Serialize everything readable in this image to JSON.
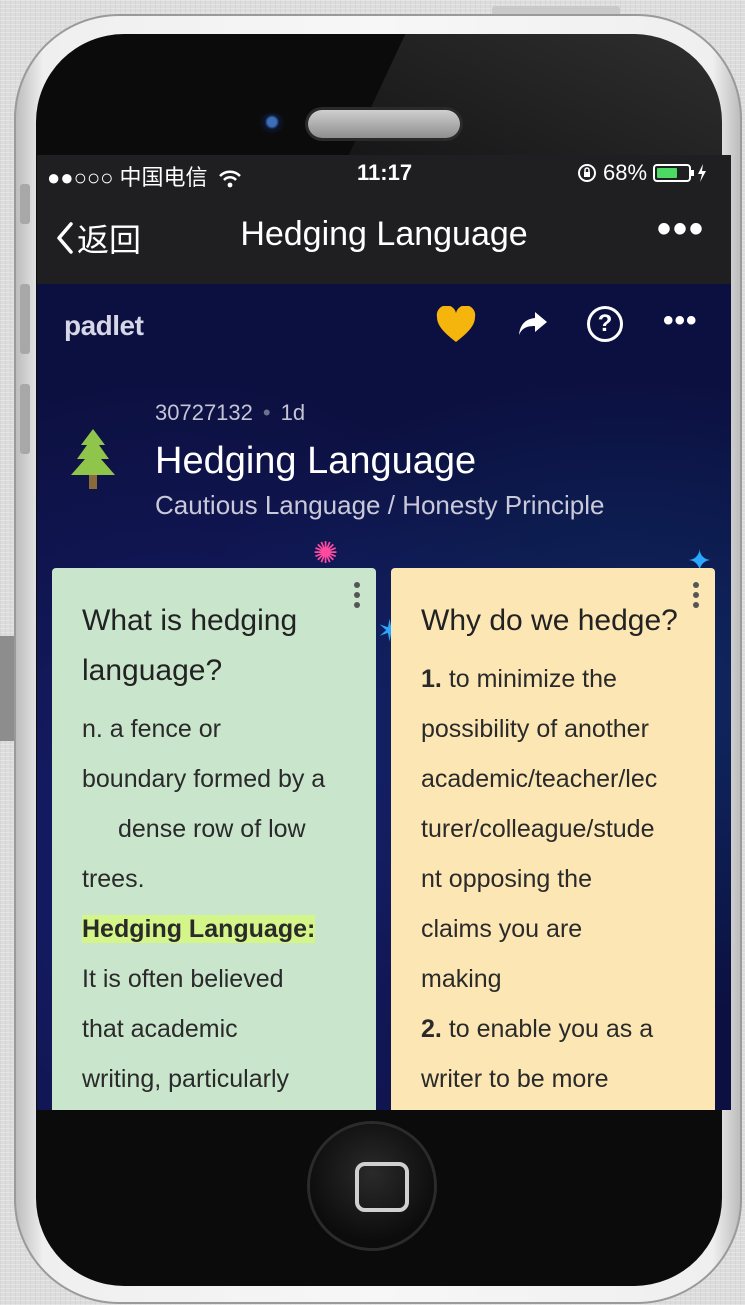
{
  "statusbar": {
    "carrier": "●●○○○ 中国电信",
    "time": "11:17",
    "battery": "68%",
    "battery_level": 0.68
  },
  "navbar": {
    "back_label": "返回",
    "title": "Hedging Language",
    "more": "•••"
  },
  "padlet": {
    "brand": "padlet",
    "liked": true,
    "more": "•••",
    "help": "?"
  },
  "board": {
    "id": "30727132",
    "age": "1d",
    "title": "Hedging Language",
    "subtitle": "Cautious Language / Honesty Principle"
  },
  "cards": [
    {
      "title": "What is hedging language?",
      "lines": {
        "l1": "n.  a fence or",
        "l2": "boundary formed by a",
        "l3": "dense row of low",
        "l4": "trees.",
        "highlight": "Hedging Language:",
        "l5": "It is often believed",
        "l6": "that academic",
        "l7": "writing, particularly"
      }
    },
    {
      "title": "Why do we hedge?",
      "lines": {
        "n1": "1.",
        "l1": "to minimize the",
        "l2": "possibility of another",
        "l3": "academic/teacher/lec",
        "l4": "turer/colleague/stude",
        "l5": "nt opposing the",
        "l6": "claims you are",
        "l7": "making",
        "n2": "2.",
        "l8": "to enable you as a",
        "l9": "writer to be more"
      }
    }
  ],
  "colors": {
    "heart": "#f5b50d",
    "card_green": "#c9e6cd",
    "card_yellow": "#fbe6b4",
    "highlight": "#d4f58a",
    "battery_fill": "#4cd964"
  },
  "icons": [
    "wifi-icon",
    "lock-rotation-icon",
    "charging-icon",
    "back-chevron-icon",
    "heart-icon",
    "share-icon",
    "help-icon",
    "tree-icon",
    "kebab-icon",
    "home-button-icon"
  ]
}
